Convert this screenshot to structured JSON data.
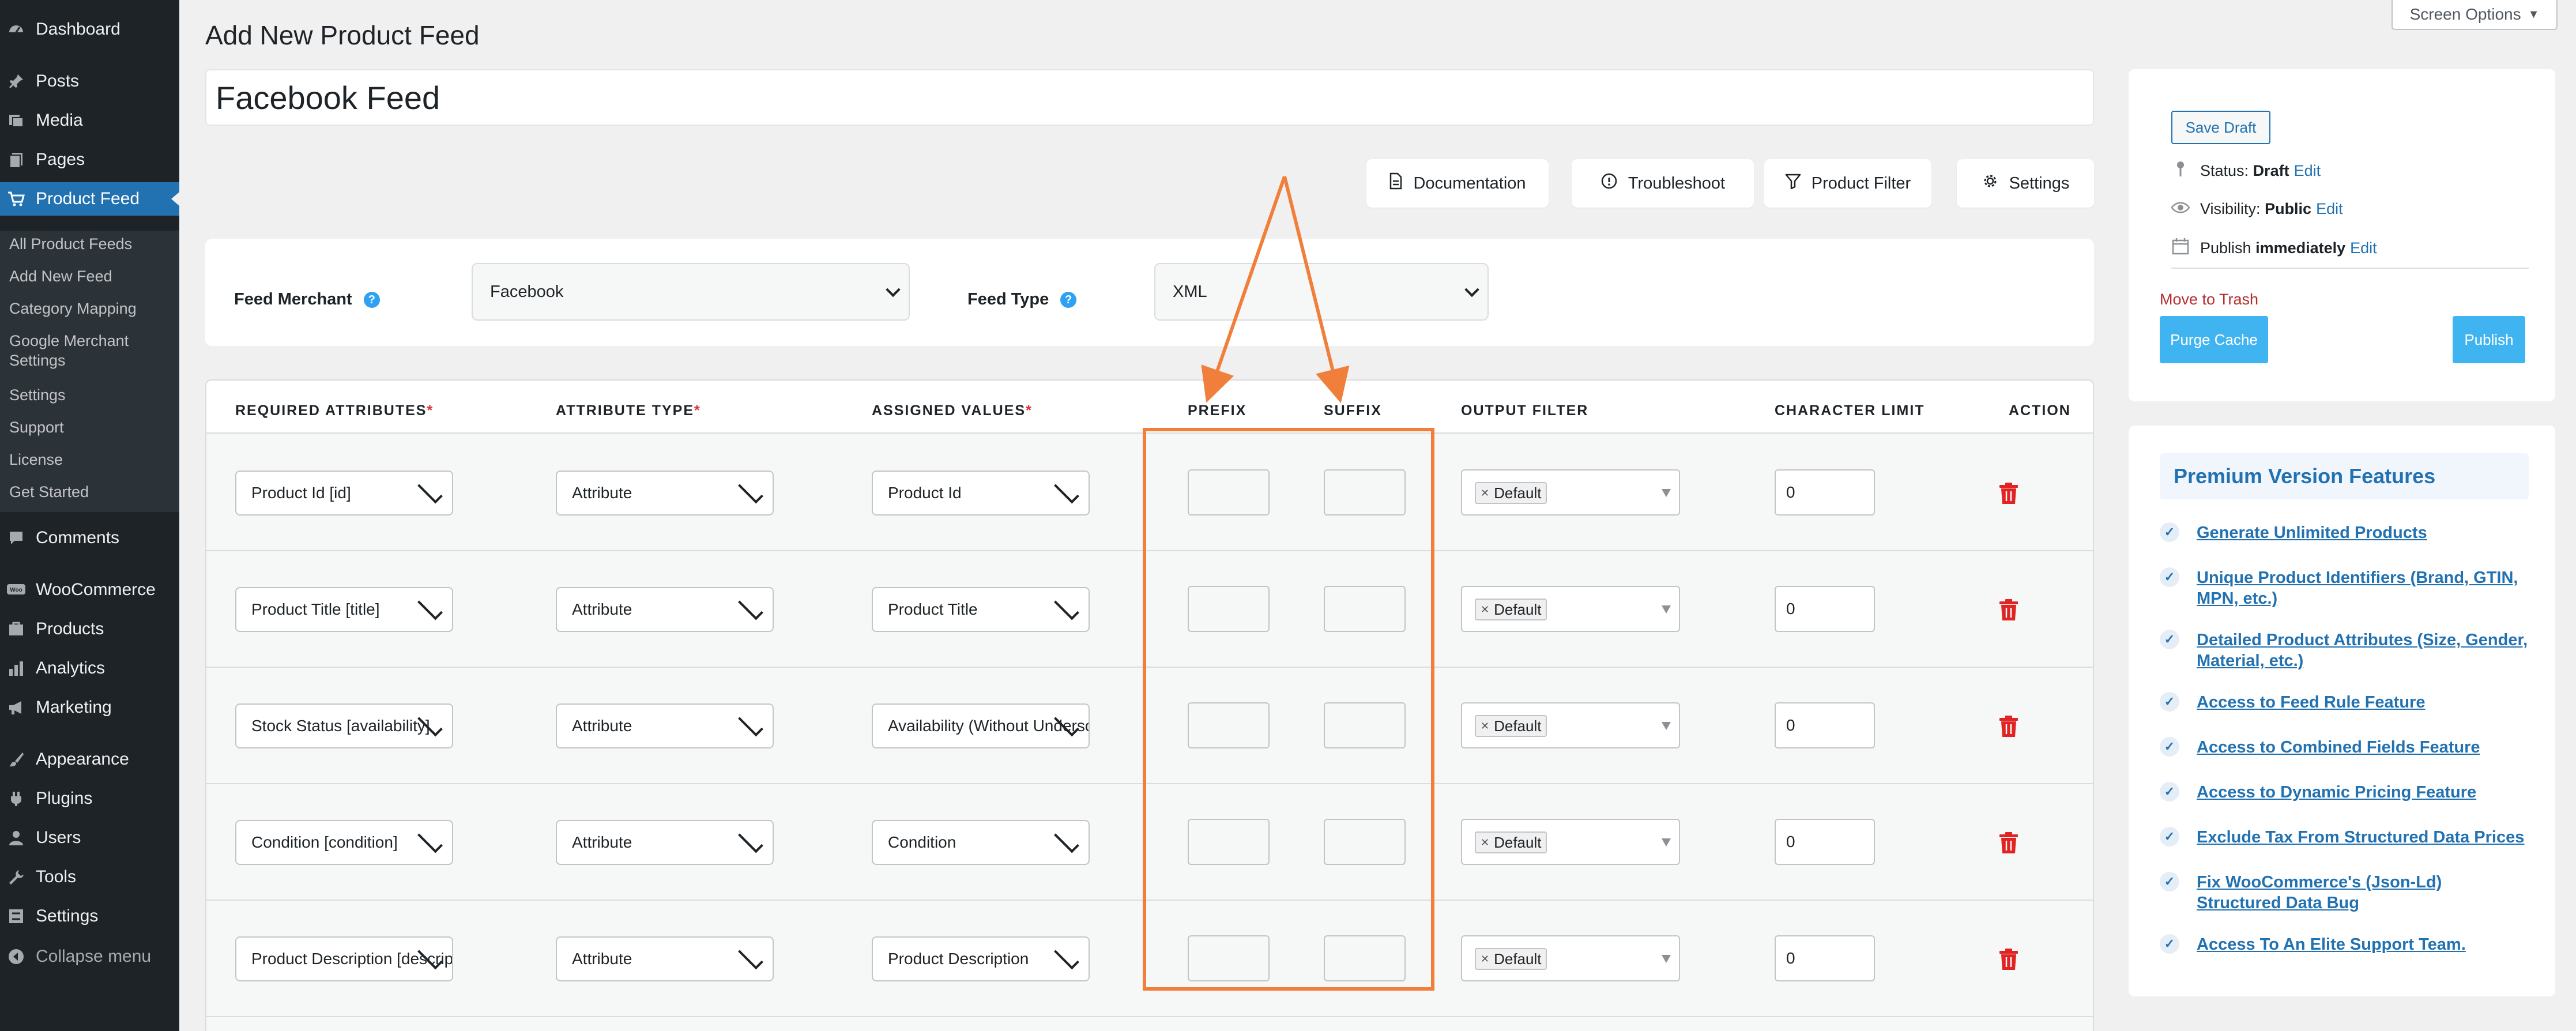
{
  "sidebar": {
    "items": [
      {
        "label": "Dashboard",
        "icon": "dashboard-icon"
      },
      {
        "label": "Posts",
        "icon": "pin-icon"
      },
      {
        "label": "Media",
        "icon": "media-icon"
      },
      {
        "label": "Pages",
        "icon": "pages-icon"
      },
      {
        "label": "Product Feed",
        "icon": "cart-icon",
        "active": true
      },
      {
        "label": "Comments",
        "icon": "comment-icon"
      },
      {
        "label": "WooCommerce",
        "icon": "woo-icon"
      },
      {
        "label": "Products",
        "icon": "products-icon"
      },
      {
        "label": "Analytics",
        "icon": "analytics-icon"
      },
      {
        "label": "Marketing",
        "icon": "megaphone-icon"
      },
      {
        "label": "Appearance",
        "icon": "brush-icon"
      },
      {
        "label": "Plugins",
        "icon": "plugin-icon"
      },
      {
        "label": "Users",
        "icon": "user-icon"
      },
      {
        "label": "Tools",
        "icon": "wrench-icon"
      },
      {
        "label": "Settings",
        "icon": "settings-icon"
      },
      {
        "label": "Collapse menu",
        "icon": "collapse-icon"
      }
    ],
    "submenu": [
      "All Product Feeds",
      "Add New Feed",
      "Category Mapping",
      "Google Merchant Settings",
      "Settings",
      "Support",
      "License",
      "Get Started"
    ]
  },
  "page": {
    "title": "Add New Product Feed",
    "screen_options": "Screen Options",
    "feed_name": "Facebook Feed"
  },
  "toolbar": {
    "documentation": "Documentation",
    "troubleshoot": "Troubleshoot",
    "product_filter": "Product Filter",
    "settings": "Settings"
  },
  "merchant": {
    "merchant_label": "Feed Merchant",
    "merchant_value": "Facebook",
    "type_label": "Feed Type",
    "type_value": "XML"
  },
  "table": {
    "headers": {
      "required": "REQUIRED ATTRIBUTES",
      "type": "ATTRIBUTE TYPE",
      "assigned": "ASSIGNED VALUES",
      "prefix": "PREFIX",
      "suffix": "SUFFIX",
      "filter": "OUTPUT FILTER",
      "limit": "CHARACTER LIMIT",
      "action": "ACTION",
      "required_mark": "*"
    },
    "rows": [
      {
        "attr": "Product Id [id]",
        "type": "Attribute",
        "value": "Product Id",
        "filter": "Default",
        "limit": "0"
      },
      {
        "attr": "Product Title [title]",
        "type": "Attribute",
        "value": "Product Title",
        "filter": "Default",
        "limit": "0"
      },
      {
        "attr": "Stock Status [availability]",
        "type": "Attribute",
        "value": "Availability (Without Underscore)",
        "filter": "Default",
        "limit": "0"
      },
      {
        "attr": "Condition [condition]",
        "type": "Attribute",
        "value": "Condition",
        "filter": "Default",
        "limit": "0"
      },
      {
        "attr": "Product Description [description]",
        "type": "Attribute",
        "value": "Product Description",
        "filter": "Default",
        "limit": "0"
      }
    ]
  },
  "publish": {
    "save_draft": "Save Draft",
    "status_label": "Status:",
    "status_value": "Draft",
    "visibility_label": "Visibility:",
    "visibility_value": "Public",
    "publish_label": "Publish",
    "publish_value": "immediately",
    "edit": "Edit",
    "move_to_trash": "Move to Trash",
    "purge_cache": "Purge Cache",
    "publish_button": "Publish"
  },
  "premium": {
    "title": "Premium Version Features",
    "features": [
      "Generate Unlimited Products",
      "Unique Product Identifiers (Brand, GTIN, MPN, etc.)",
      "Detailed Product Attributes (Size, Gender, Material, etc.)",
      "Access to Feed Rule Feature",
      "Access to Combined Fields Feature",
      "Access to Dynamic Pricing Feature",
      "Exclude Tax From Structured Data Prices",
      "Fix WooCommerce's (Json-Ld) Structured Data Bug",
      "Access To An Elite Support Team."
    ]
  },
  "colors": {
    "accent": "#2271b1",
    "highlight": "#f07f3c",
    "sidebar": "#1d2327",
    "danger": "#e02424"
  }
}
